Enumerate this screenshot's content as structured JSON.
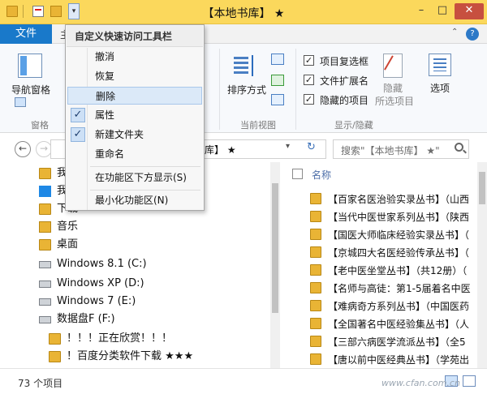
{
  "window": {
    "title": "【本地书库】 ★",
    "minimize_glyph": "–",
    "maximize_glyph": "□",
    "close_glyph": "✕",
    "dropdown_glyph": "▾"
  },
  "ribbon_tabs": {
    "file": "文件",
    "peek": "主"
  },
  "ribbon": {
    "nav_pane": "导航窗格",
    "pane_group": "窗格",
    "sort_by": "排序方式",
    "current_view_group": "当前视图",
    "item_checkboxes": "项目复选框",
    "file_extensions": "文件扩展名",
    "hidden_items": "隐藏的项目",
    "hide_selected_1": "隐藏",
    "hide_selected_2": "所选项目",
    "show_hide_group": "显示/隐藏",
    "options": "选项",
    "check_glyph": "✓"
  },
  "address": {
    "path": "书库】 ★",
    "back_glyph": "←",
    "forward_glyph": "→",
    "refresh_glyph": "↻",
    "search_placeholder": "搜索\"【本地书库】 ★\""
  },
  "qat_menu": {
    "title": "自定义快速访问工具栏",
    "items": [
      {
        "label": "撤消",
        "checked": false
      },
      {
        "label": "恢复",
        "checked": false
      },
      {
        "label": "删除",
        "checked": false
      },
      {
        "label": "属性",
        "checked": true
      },
      {
        "label": "新建文件夹",
        "checked": true
      },
      {
        "label": "重命名",
        "checked": false
      },
      {
        "label": "在功能区下方显示(S)",
        "checked": false
      },
      {
        "label": "最小化功能区(N)",
        "checked": false
      }
    ],
    "check_glyph": "✓"
  },
  "nav_items": [
    {
      "label": "我",
      "icon": "pictures-folder-icon"
    },
    {
      "label": "我",
      "icon": "library-icon"
    },
    {
      "label": "下载",
      "icon": "downloads-folder-icon"
    },
    {
      "label": "音乐",
      "icon": "music-folder-icon"
    },
    {
      "label": "桌面",
      "icon": "desktop-folder-icon"
    },
    {
      "label": "Windows 8.1 (C:)",
      "icon": "windows-drive-icon"
    },
    {
      "label": "Windows XP (D:)",
      "icon": "drive-icon"
    },
    {
      "label": "Windows 7 (E:)",
      "icon": "drive-icon"
    },
    {
      "label": "数据盘F (F:)",
      "icon": "drive-icon"
    },
    {
      "label": "！！！正在欣赏！！！",
      "icon": "folder-icon"
    },
    {
      "label": "！百度分类软件下载 ★★★",
      "icon": "folder-icon"
    }
  ],
  "file_list": {
    "column_name": "名称",
    "rows": [
      "【百家名医治验实录丛书】（山西",
      "【当代中医世家系列丛书】（陕西",
      "【国医大师临床经验实录丛书】（",
      "【京城四大名医经验传承丛书】（",
      "【老中医坐堂丛书】（共12册）（",
      "【名师与高徒：第1-5届着名中医",
      "【难病奇方系列丛书】（中国医药",
      "【全国著名中医经验集丛书】（人",
      "【三部六病医学流派丛书】（全5",
      "【唐以前中医经典丛书】（学苑出"
    ]
  },
  "status": {
    "count": "73 个项目"
  },
  "watermark": "www.cfan.com.cn"
}
